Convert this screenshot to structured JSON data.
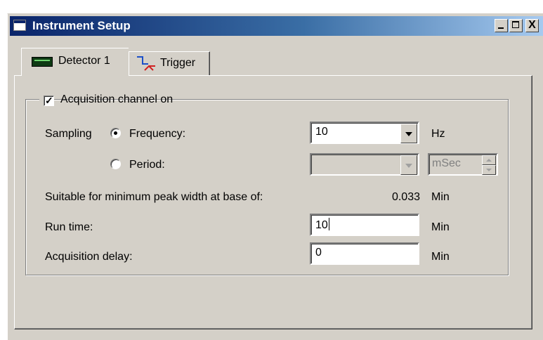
{
  "window": {
    "title": "Instrument Setup",
    "controls": [
      "minimize",
      "maximize",
      "close"
    ],
    "close_glyph": "X"
  },
  "tabs": [
    {
      "label": "Detector 1",
      "icon": "detector-board-icon",
      "selected": true
    },
    {
      "label": "Trigger",
      "icon": "trigger-icon",
      "selected": false
    }
  ],
  "acquisition": {
    "checkbox_label": "Acquisition channel on",
    "checked": true
  },
  "sampling": {
    "label": "Sampling",
    "frequency_label": "Frequency:",
    "frequency_value": "10",
    "frequency_unit": "Hz",
    "period_label": "Period:",
    "period_value": "",
    "period_unit": "mSec",
    "selected": "frequency"
  },
  "peak_width": {
    "label": "Suitable for minimum peak width at base of:",
    "value": "0.033",
    "unit": "Min"
  },
  "run_time": {
    "label": "Run time:",
    "value": "10",
    "unit": "Min"
  },
  "acquisition_delay": {
    "label": "Acquisition delay:",
    "value": "0",
    "unit": "Min"
  },
  "colors": {
    "titlebar_start": "#0a246a",
    "titlebar_end": "#a6caf0",
    "face": "#d4d0c8"
  }
}
